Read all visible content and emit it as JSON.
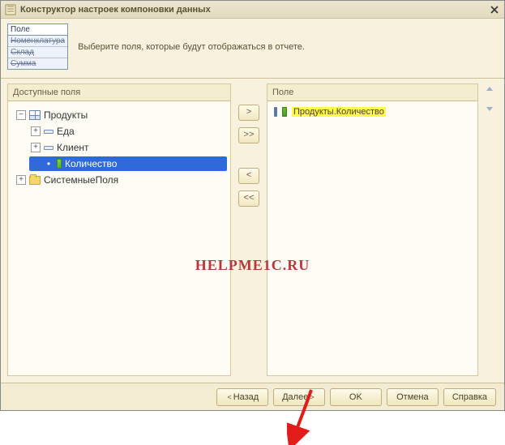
{
  "window": {
    "title": "Конструктор настроек компоновки данных"
  },
  "tags": {
    "head": "Поле",
    "items": [
      "Номенклатура",
      "Склад",
      "Сумма"
    ]
  },
  "info_text": "Выберите поля, которые будут отображаться в отчете.",
  "left_panel": {
    "header": "Доступные поля",
    "tree": {
      "root": "Продукты",
      "children": {
        "food": "Еда",
        "client": "Клиент",
        "qty": "Количество"
      },
      "system": "СистемныеПоля"
    }
  },
  "transfer": {
    "add": ">",
    "add_all": ">>",
    "remove": "<",
    "remove_all": "<<"
  },
  "right_panel": {
    "header": "Поле",
    "items": {
      "r0": "Продукты.Количество"
    }
  },
  "watermark": "HELPME1C.RU",
  "footer": {
    "back": "Назад",
    "next": "Далее",
    "ok": "OK",
    "cancel": "Отмена",
    "help": "Справка"
  }
}
